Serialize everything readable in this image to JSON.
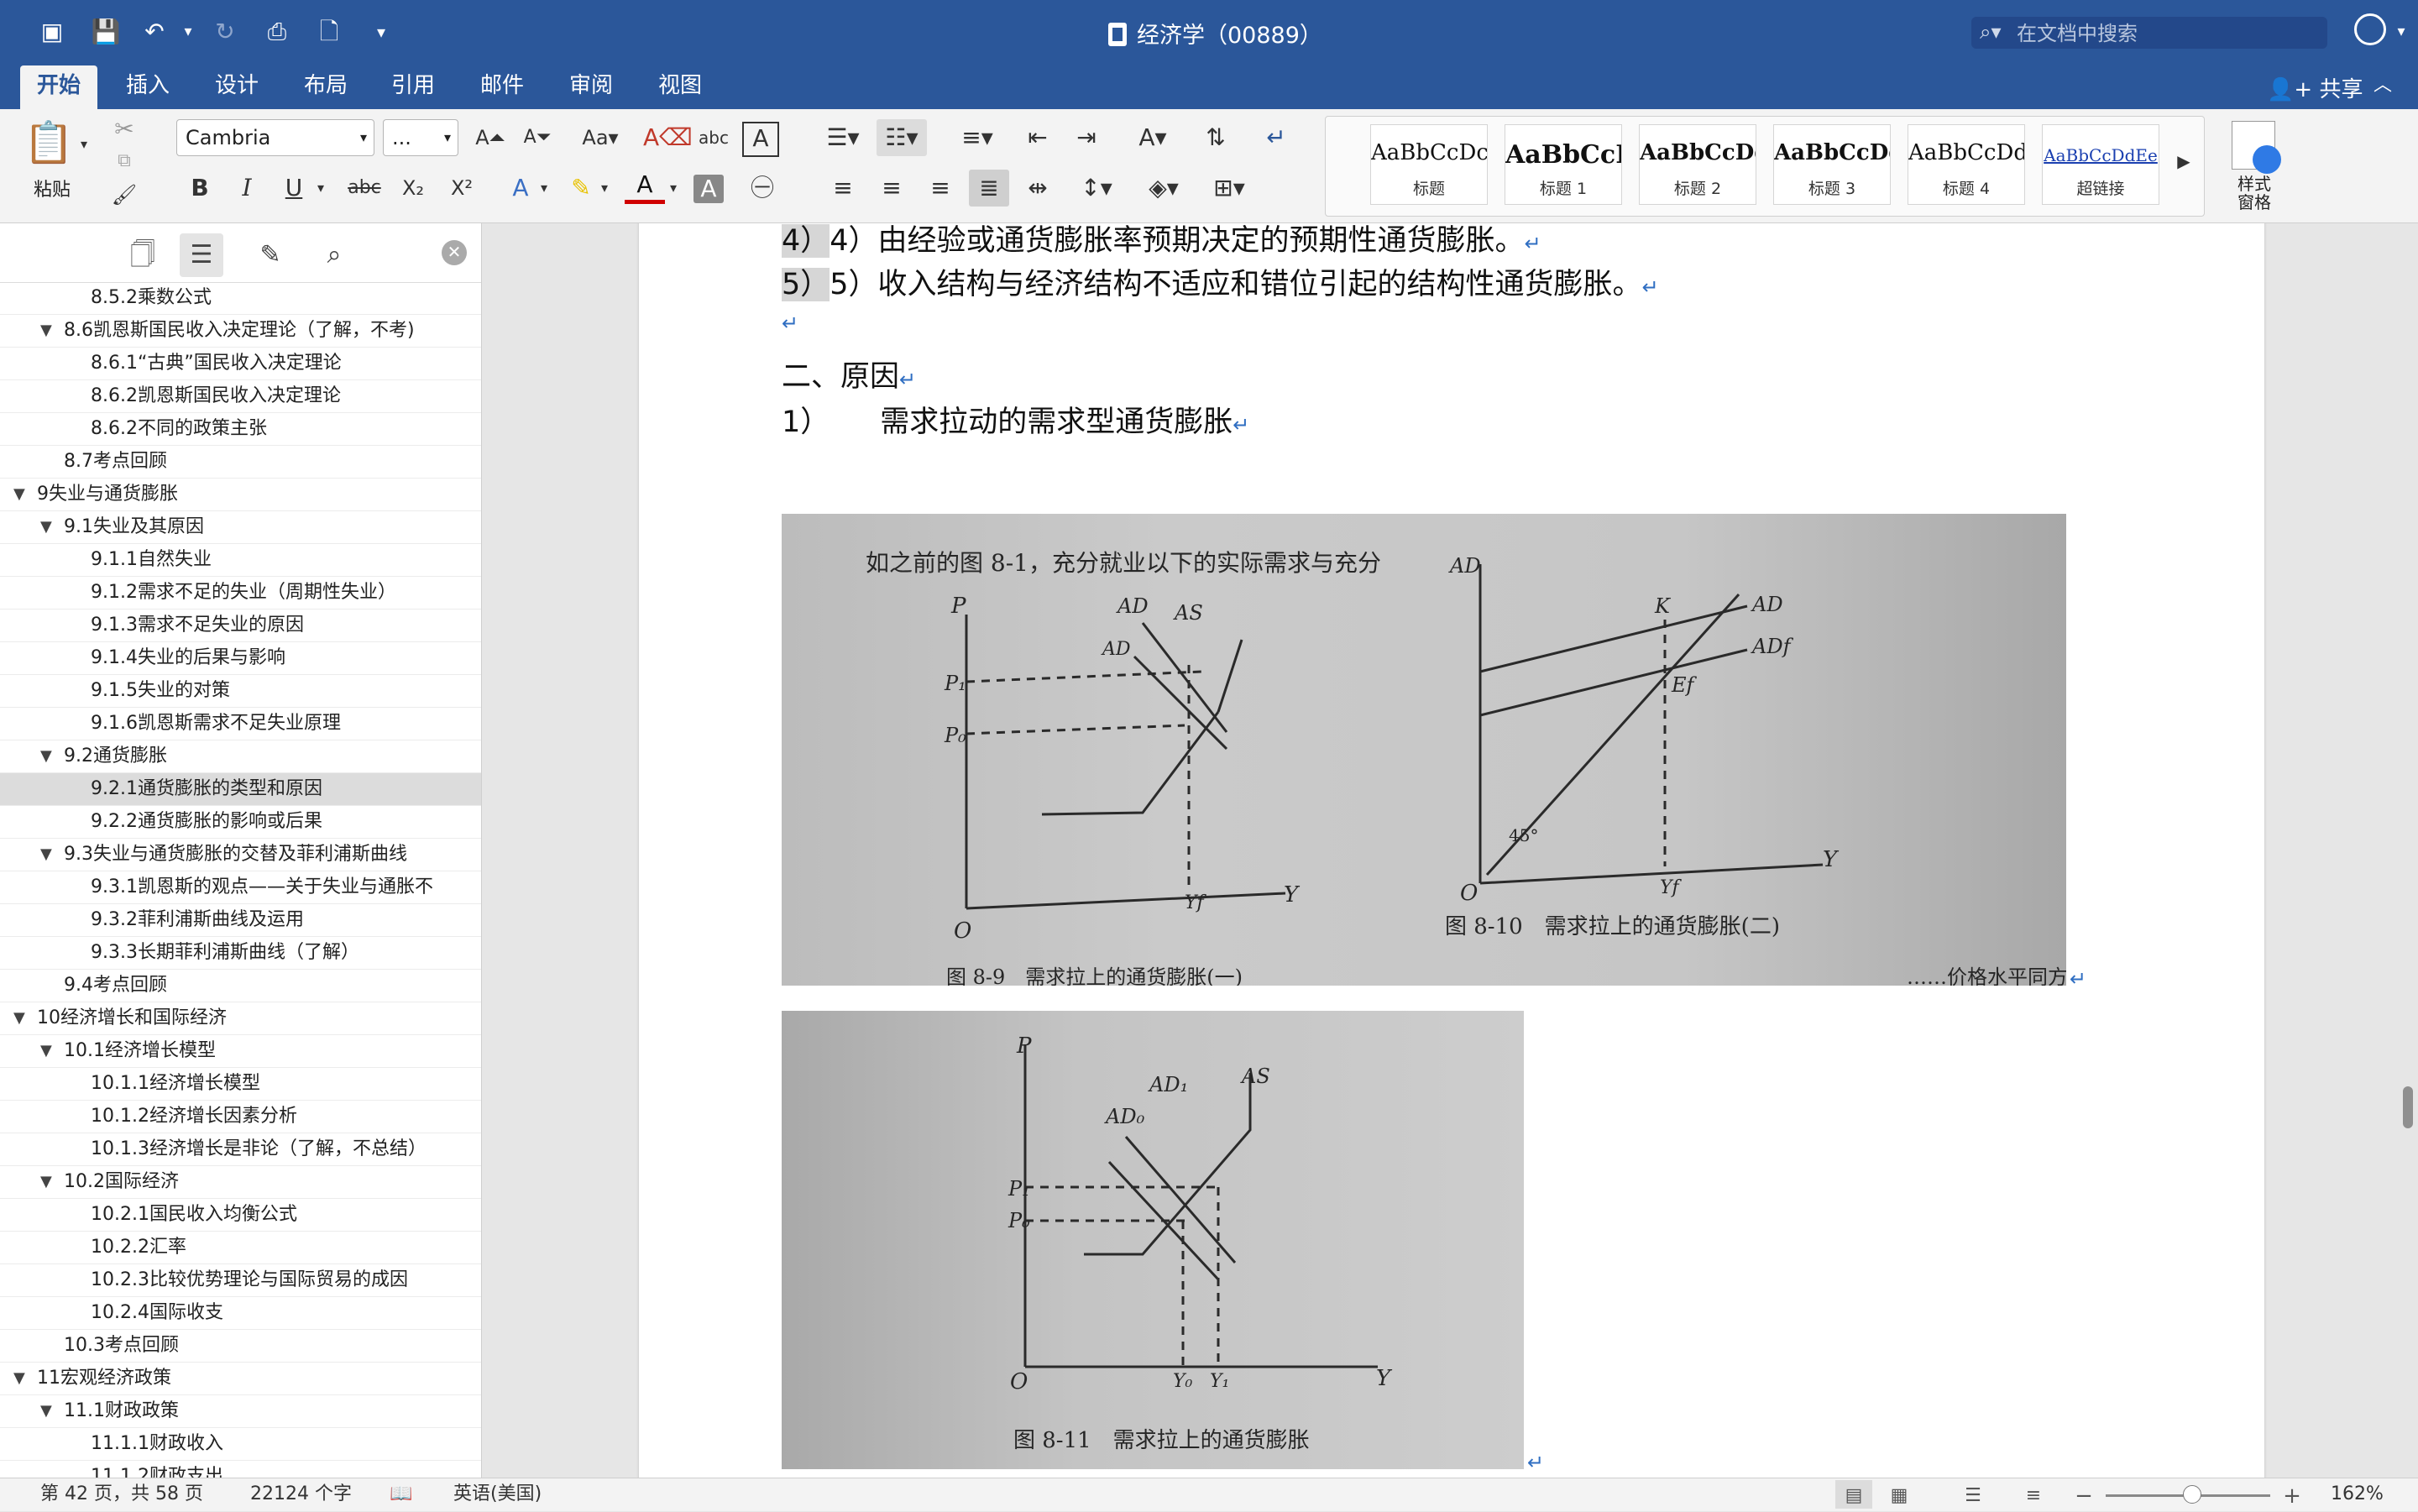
{
  "window": {
    "title": "经济学（00889）"
  },
  "search": {
    "placeholder": "在文档中搜索"
  },
  "tabs": [
    {
      "label": "开始"
    },
    {
      "label": "插入"
    },
    {
      "label": "设计"
    },
    {
      "label": "布局"
    },
    {
      "label": "引用"
    },
    {
      "label": "邮件"
    },
    {
      "label": "审阅"
    },
    {
      "label": "视图"
    }
  ],
  "share_label": "共享",
  "ribbon": {
    "paste_label": "粘贴",
    "font_name": "Cambria",
    "font_size": "...",
    "styles": [
      {
        "sample": "AaBbCcDc",
        "name": "标题"
      },
      {
        "sample": "AaBbCcI",
        "name": "标题 1"
      },
      {
        "sample": "AaBbCcDdI",
        "name": "标题 2"
      },
      {
        "sample": "AaBbCcDd",
        "name": "标题 3"
      },
      {
        "sample": "AaBbCcDdE",
        "name": "标题 4"
      },
      {
        "sample": "AaBbCcDdEe",
        "name": "超链接"
      }
    ],
    "styles_pane_label_1": "样式",
    "styles_pane_label_2": "窗格"
  },
  "nav": {
    "items": [
      {
        "text": "8.5.2乘数公式",
        "level": 3
      },
      {
        "text": "8.6凯恩斯国民收入决定理论（了解，不考)",
        "level": 2,
        "expanded": true
      },
      {
        "text": "8.6.1“古典”国民收入决定理论",
        "level": 3
      },
      {
        "text": "8.6.2凯恩斯国民收入决定理论",
        "level": 3
      },
      {
        "text": "8.6.2不同的政策主张",
        "level": 3
      },
      {
        "text": "8.7考点回顾",
        "level": 2
      },
      {
        "text": "9失业与通货膨胀",
        "level": 1,
        "expanded": true
      },
      {
        "text": "9.1失业及其原因",
        "level": 2,
        "expanded": true
      },
      {
        "text": "9.1.1自然失业",
        "level": 3
      },
      {
        "text": "9.1.2需求不足的失业（周期性失业）",
        "level": 3
      },
      {
        "text": "9.1.3需求不足失业的原因",
        "level": 3
      },
      {
        "text": "9.1.4失业的后果与影响",
        "level": 3
      },
      {
        "text": "9.1.5失业的对策",
        "level": 3
      },
      {
        "text": "9.1.6凯恩斯需求不足失业原理",
        "level": 3
      },
      {
        "text": "9.2通货膨胀",
        "level": 2,
        "expanded": true
      },
      {
        "text": "9.2.1通货膨胀的类型和原因",
        "level": 3,
        "selected": true
      },
      {
        "text": "9.2.2通货膨胀的影响或后果",
        "level": 3
      },
      {
        "text": "9.3失业与通货膨胀的交替及菲利浦斯曲线",
        "level": 2,
        "expanded": true
      },
      {
        "text": "9.3.1凯恩斯的观点——关于失业与通胀不",
        "level": 3
      },
      {
        "text": "9.3.2菲利浦斯曲线及运用",
        "level": 3
      },
      {
        "text": "9.3.3长期菲利浦斯曲线（了解）",
        "level": 3
      },
      {
        "text": "9.4考点回顾",
        "level": 2
      },
      {
        "text": "10经济增长和国际经济",
        "level": 1,
        "expanded": true
      },
      {
        "text": "10.1经济增长模型",
        "level": 2,
        "expanded": true
      },
      {
        "text": "10.1.1经济增长模型",
        "level": 3
      },
      {
        "text": "10.1.2经济增长因素分析",
        "level": 3
      },
      {
        "text": "10.1.3经济增长是非论（了解，不总结）",
        "level": 3
      },
      {
        "text": "10.2国际经济",
        "level": 2,
        "expanded": true
      },
      {
        "text": "10.2.1国民收入均衡公式",
        "level": 3
      },
      {
        "text": "10.2.2汇率",
        "level": 3
      },
      {
        "text": "10.2.3比较优势理论与国际贸易的成因",
        "level": 3
      },
      {
        "text": "10.2.4国际收支",
        "level": 3
      },
      {
        "text": "10.3考点回顾",
        "level": 2
      },
      {
        "text": "11宏观经济政策",
        "level": 1,
        "expanded": true
      },
      {
        "text": "11.1财政政策",
        "level": 2,
        "expanded": true
      },
      {
        "text": "11.1.1财政收入",
        "level": 3
      },
      {
        "text": "11.1.2财政支出",
        "level": 3
      },
      {
        "text": "11.1.3财政政策的运用",
        "level": 3
      }
    ]
  },
  "document": {
    "para_4": "4）由经验或通货膨胀率预期决定的预期性通货膨胀。",
    "para_5": "5）收入结构与经济结构不适应和错位引起的结构性通货膨胀。",
    "heading_2": "二、原因",
    "item_1_num": "1）",
    "item_1_text": "需求拉动的需求型通货膨胀",
    "figures": {
      "intro_text": "如之前的图 8-1，充分就业以下的实际需求与充分",
      "fig9_caption": "图 8-9　需求拉上的通货膨胀(一)",
      "fig10_caption": "图 8-10　需求拉上的通货膨胀(二)",
      "fig11_caption": "图 8-11　需求拉上的通货膨胀",
      "bottom_text": "……价格水平同方向变动",
      "labels": {
        "P": "P",
        "O": "O",
        "Y": "Y",
        "AD": "AD",
        "AS": "AS",
        "AD1": "AD₁",
        "AD0": "AD₀",
        "P1": "P₁",
        "P0": "P₀",
        "Yf": "Yf",
        "Y0": "Y₀",
        "Y1": "Y₁",
        "K": "K",
        "Ef": "Ef",
        "ADf": "ADf",
        "deg45": "45°"
      }
    }
  },
  "status": {
    "page": "第 42 页，共 58 页",
    "words": "22124 个字",
    "language": "英语(美国)",
    "zoom": "162%",
    "zoom_level": 0.52
  }
}
